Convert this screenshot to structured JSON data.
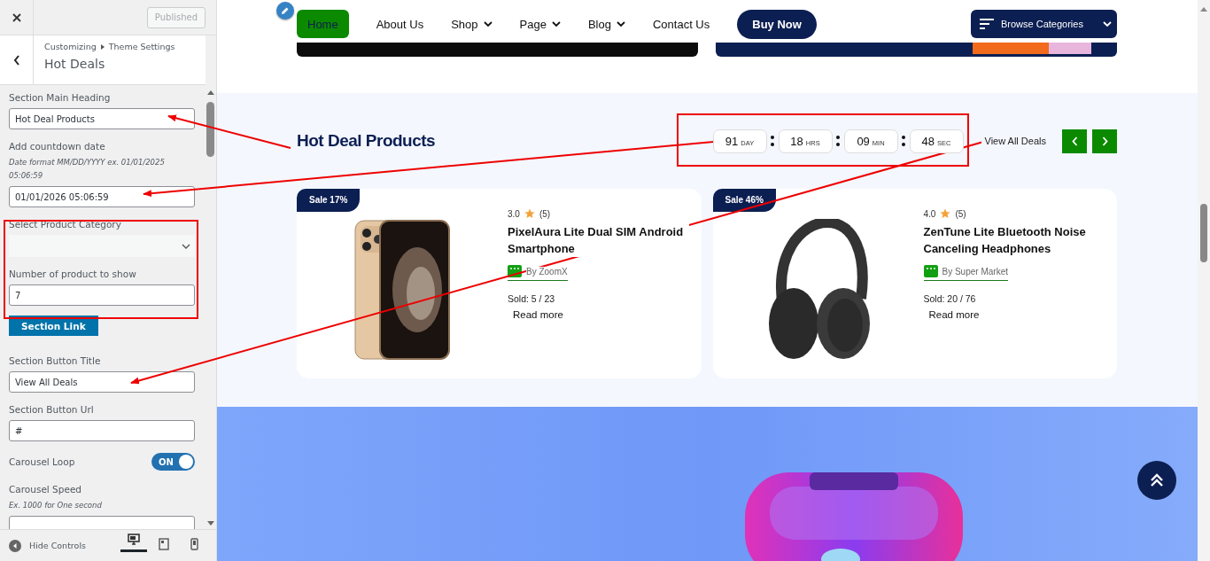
{
  "sidebar": {
    "publish_button": {
      "label": "Published",
      "disabled": true
    },
    "breadcrumb": [
      "Customizing",
      "Theme Settings"
    ],
    "title": "Hot Deals",
    "controls": [
      {
        "kind": "text",
        "label": "Section Main Heading",
        "value": "Hot Deal Products"
      },
      {
        "kind": "text",
        "label": "Add countdown date",
        "description": "Date format MM/DD/YYYY ex. 01/01/2025 05:06:59",
        "value": "01/01/2026 05:06:59"
      },
      {
        "kind": "select",
        "label": "Select Product Category"
      },
      {
        "kind": "text",
        "label": "Number of product to show",
        "value": "7"
      },
      {
        "kind": "button",
        "label": "Section Link"
      },
      {
        "kind": "text",
        "label": "Section Button Title",
        "value": "View All Deals"
      },
      {
        "kind": "text",
        "label": "Section Button Url",
        "value": "#"
      },
      {
        "kind": "toggle",
        "label": "Carousel Loop",
        "on": true,
        "state_label": "ON"
      },
      {
        "kind": "text",
        "label": "Carousel Speed",
        "description": "Ex. 1000 for One second"
      }
    ],
    "hide_controls": "Hide Controls",
    "devices": [
      {
        "kind": "desktop",
        "selected": true
      },
      {
        "kind": "tablet",
        "selected": false
      },
      {
        "kind": "mobile",
        "selected": false
      }
    ]
  },
  "preview": {
    "nav": [
      {
        "label": "Home",
        "selected": true,
        "dropdown": false
      },
      {
        "label": "About Us",
        "selected": false,
        "dropdown": false
      },
      {
        "label": "Shop",
        "selected": false,
        "dropdown": true
      },
      {
        "label": "Page",
        "selected": false,
        "dropdown": true
      },
      {
        "label": "Blog",
        "selected": false,
        "dropdown": true
      },
      {
        "label": "Contact Us",
        "selected": false,
        "dropdown": false
      }
    ],
    "buy_button": "Buy Now",
    "browse_button": "Browse Categories",
    "hot_deals": {
      "heading": "Hot Deal Products",
      "countdown": [
        {
          "value": "91",
          "unit": "DAY"
        },
        {
          "value": "18",
          "unit": "HRS"
        },
        {
          "value": "09",
          "unit": "MIN"
        },
        {
          "value": "48",
          "unit": "SEC"
        }
      ],
      "view_all": "View All Deals",
      "products": [
        {
          "kind": "phone",
          "sale": "Sale 17%",
          "rating": "3.0",
          "reviews": "(5)",
          "name": "PixelAura Lite Dual SIM Android Smartphone",
          "vendor": "By ZoomX",
          "sold": "Sold: 5 / 23",
          "read_more": "Read more"
        },
        {
          "kind": "headphones",
          "sale": "Sale 46%",
          "rating": "4.0",
          "reviews": "(5)",
          "name": "ZenTune Lite Bluetooth Noise Canceling Headphones",
          "vendor": "By Super Market",
          "sold": "Sold: 20 / 76",
          "read_more": "Read more"
        }
      ]
    }
  }
}
